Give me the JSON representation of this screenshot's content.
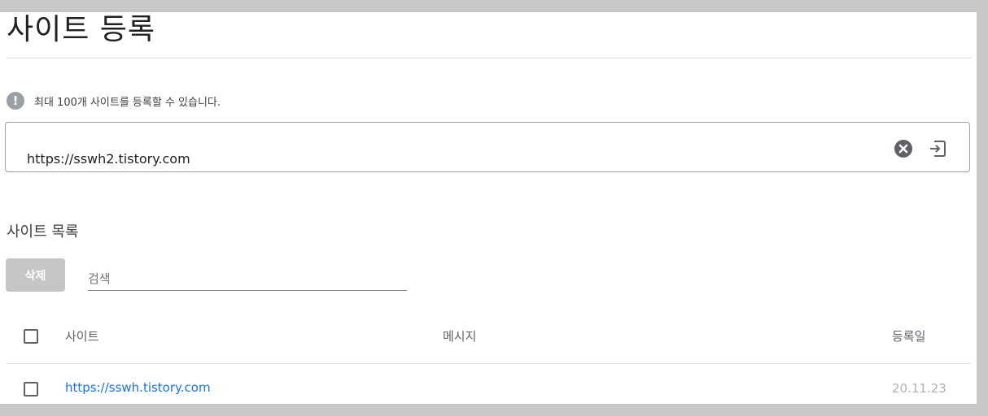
{
  "page": {
    "title": "사이트 등록",
    "info_text": "최대 100개 사이트를 등록할 수 있습니다.",
    "info_icon": "exclamation-icon",
    "colors": {
      "highlight": "#e0141e",
      "link": "#1a73e8",
      "delete_button_bg": "#c6c6c6"
    }
  },
  "url_field": {
    "value": "https://sswh2.tistory.com",
    "clear_icon": "close-circle-icon",
    "submit_icon": "enter-icon"
  },
  "list": {
    "title": "사이트 목록",
    "delete_label": "삭제",
    "search_placeholder": "검색",
    "columns": [
      "사이트",
      "메시지",
      "등록일"
    ],
    "rows": [
      {
        "site": "https://sswh.tistory.com",
        "message": "",
        "date": "20.11.23",
        "checked": false
      }
    ]
  }
}
